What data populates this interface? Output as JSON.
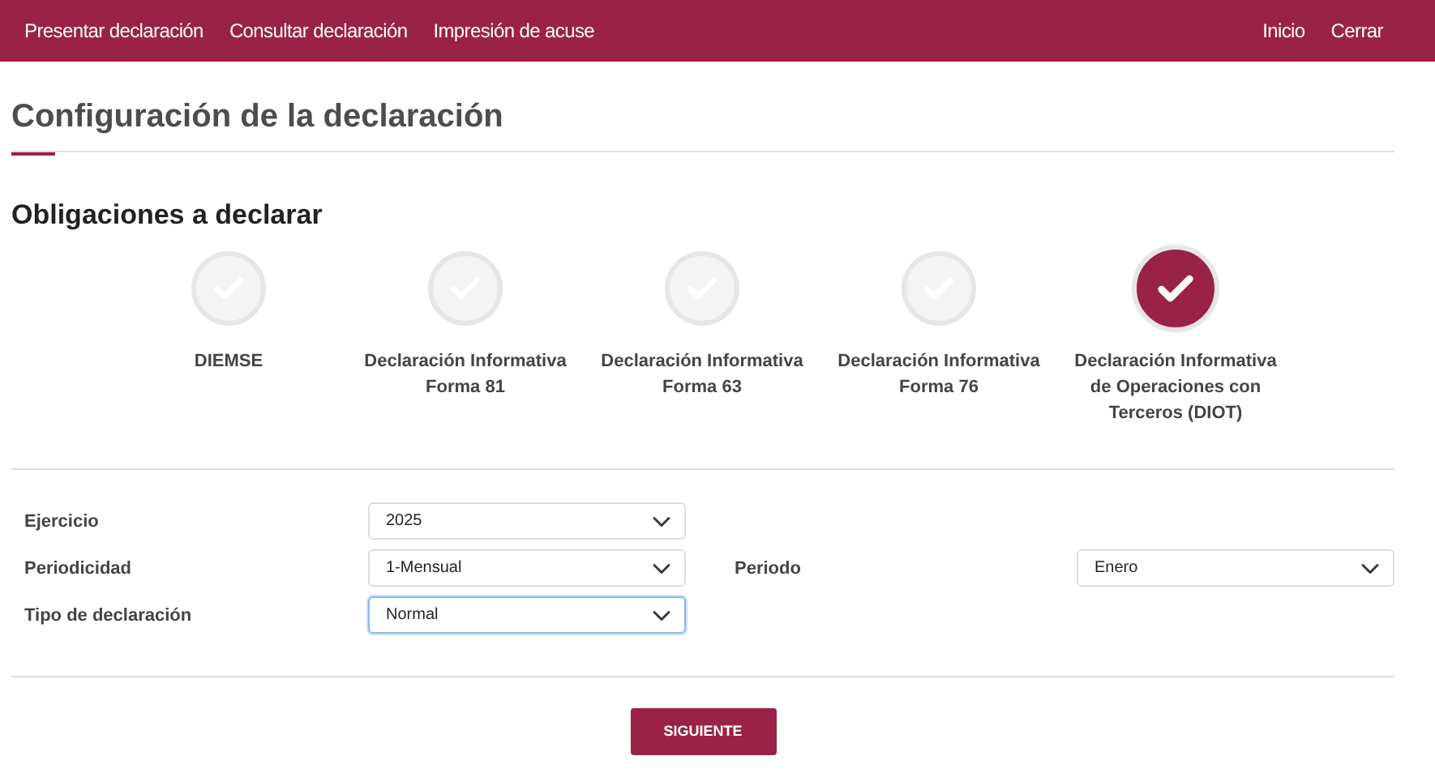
{
  "navbar": {
    "left_links": [
      "Presentar declaración",
      "Consultar declaración",
      "Impresión de acuse"
    ],
    "right_links": [
      "Inicio",
      "Cerrar"
    ]
  },
  "page_title": "Configuración de la declaración",
  "section_title": "Obligaciones a declarar",
  "obligations": [
    {
      "label": "DIEMSE",
      "selected": false
    },
    {
      "label": "Declaración Informativa Forma 81",
      "selected": false
    },
    {
      "label": "Declaración Informativa Forma 63",
      "selected": false
    },
    {
      "label": "Declaración Informativa Forma 76",
      "selected": false
    },
    {
      "label": "Declaración Informativa de Operaciones con Terceros (DIOT)",
      "selected": true
    }
  ],
  "form_rows": [
    [
      {
        "label": "Ejercicio",
        "value": "2025",
        "focused": false
      }
    ],
    [
      {
        "label": "Periodicidad",
        "value": "1-Mensual",
        "focused": false
      },
      {
        "label": "Periodo",
        "value": "Enero",
        "focused": false
      }
    ],
    [
      {
        "label": "Tipo de declaración",
        "value": "Normal",
        "focused": true
      }
    ]
  ],
  "next_button": "SIGUIENTE"
}
